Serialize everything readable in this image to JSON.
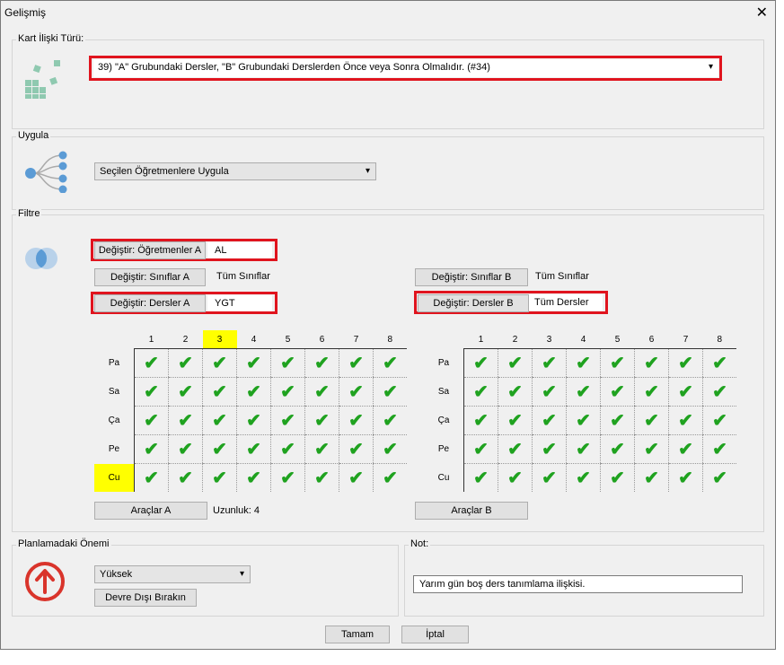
{
  "window": {
    "title": "Gelişmiş",
    "close_glyph": "✕"
  },
  "card_type": {
    "label": "Kart İlişki Türü:",
    "selected": "39) \"A\" Grubundaki Dersler, \"B\" Grubundaki Derslerden Önce veya Sonra Olmalıdır. (#34)"
  },
  "apply": {
    "label": "Uygula",
    "selected": "Seçilen Öğretmenlere Uygula"
  },
  "filter": {
    "label": "Filtre",
    "teachers_a": {
      "button": "Değiştir: Öğretmenler A",
      "value": "AL"
    },
    "classes_a": {
      "button": "Değiştir: Sınıflar A",
      "value": "Tüm Sınıflar"
    },
    "lessons_a": {
      "button": "Değiştir: Dersler A",
      "value": "YGT"
    },
    "classes_b": {
      "button": "Değiştir: Sınıflar B",
      "value": "Tüm Sınıflar"
    },
    "lessons_b": {
      "button": "Değiştir: Dersler B",
      "value": "Tüm Dersler"
    }
  },
  "grid_a": {
    "columns": [
      "1",
      "2",
      "3",
      "4",
      "5",
      "6",
      "7",
      "8"
    ],
    "rows": [
      "Pa",
      "Sa",
      "Ça",
      "Pe",
      "Cu"
    ],
    "highlight_column": "3",
    "highlight_row": "Cu",
    "tools_button": "Araçlar A",
    "length_label": "Uzunluk: 4"
  },
  "grid_b": {
    "columns": [
      "1",
      "2",
      "3",
      "4",
      "5",
      "6",
      "7",
      "8"
    ],
    "rows": [
      "Pa",
      "Sa",
      "Ça",
      "Pe",
      "Cu"
    ],
    "tools_button": "Araçlar B"
  },
  "importance": {
    "label": "Planlamadaki Önemi",
    "selected": "Yüksek",
    "disable_button": "Devre Dışı Bırakın"
  },
  "note": {
    "label": "Not:",
    "value": "Yarım gün boş ders tanımlama ilişkisi."
  },
  "footer": {
    "ok": "Tamam",
    "cancel": "İptal"
  },
  "colors": {
    "highlight": "#ffff00",
    "red_frame": "#e0141e",
    "check": "#1fa21f",
    "icon_teal": "#8fc9b0",
    "icon_blue": "#5b9bd5",
    "icon_red": "#d9342b"
  },
  "check_glyph": "✔"
}
